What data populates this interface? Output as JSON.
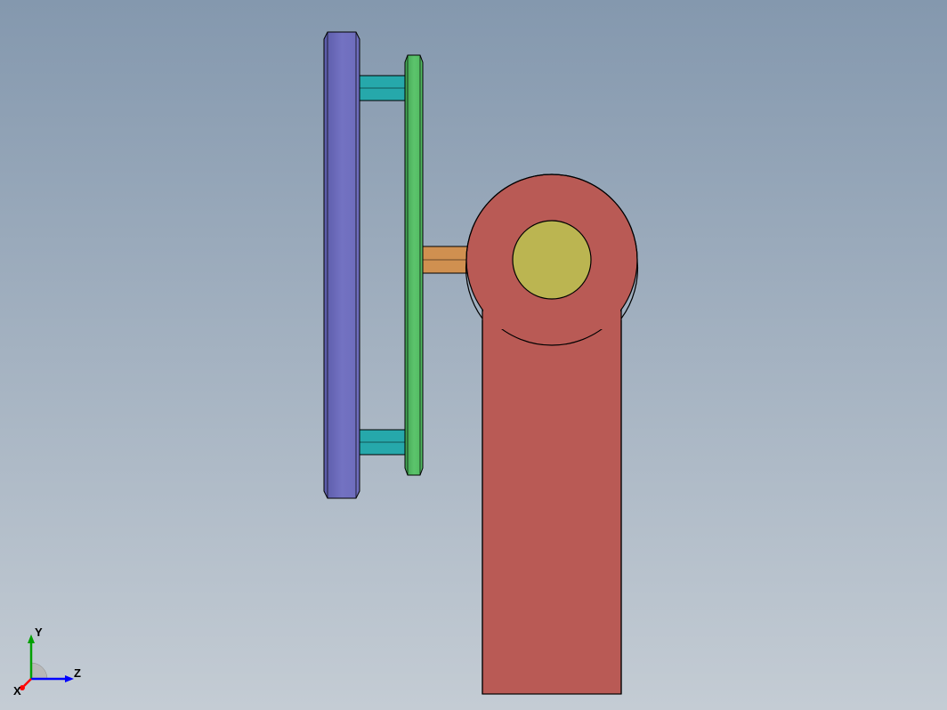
{
  "chart_data": {
    "type": "cad-assembly-view",
    "title": "",
    "view_direction": "side (YZ plane, looking along X)",
    "components": [
      {
        "name": "purple-disc-plate",
        "shape": "rectangular-slab",
        "color": "#6d6cbc",
        "z_pos": -1,
        "y_extent": "tall",
        "notes": "leftmost vertical plate, chamfered ends"
      },
      {
        "name": "teal-standoff-upper",
        "shape": "cylinder",
        "color": "#26a8ab",
        "notes": "connects purple plate to green plate, upper"
      },
      {
        "name": "teal-standoff-lower",
        "shape": "cylinder",
        "color": "#26a8ab",
        "notes": "connects purple plate to green plate, lower"
      },
      {
        "name": "green-disc-plate",
        "shape": "rectangular-slab",
        "color": "#4fb95f",
        "z_pos": 0,
        "y_extent": "tall",
        "notes": "second vertical plate, chamfered ends"
      },
      {
        "name": "orange-shaft",
        "shape": "cylinder",
        "color": "#d09050",
        "notes": "connects green plate to red bracket boss"
      },
      {
        "name": "red-bracket",
        "shape": "arm-with-round-boss",
        "color": "#b95a55",
        "z_pos": 1,
        "y_extent": "long-below",
        "notes": "vertical arm with circular top end"
      },
      {
        "name": "yellow-pin-endcap",
        "shape": "circle",
        "color": "#bbb551",
        "notes": "visible end face of pin inside red boss"
      }
    ],
    "axis_triad": {
      "labels": [
        "X",
        "Y",
        "Z"
      ],
      "colors": {
        "X": "#ff0000",
        "Y": "#00a000",
        "Z": "#0000ff"
      },
      "orientation": "Y up, Z right, X into screen"
    }
  },
  "axes": {
    "x_label": "X",
    "y_label": "Y",
    "z_label": "Z"
  }
}
